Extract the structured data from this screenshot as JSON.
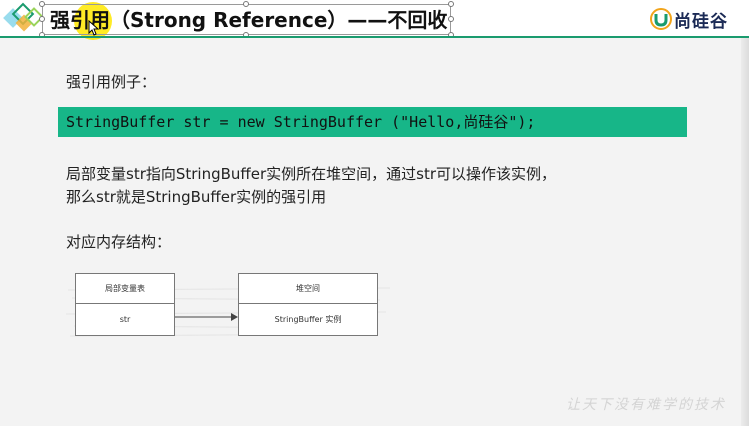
{
  "header": {
    "title": "强引用（Strong Reference）——不回收",
    "brand": "尚硅谷",
    "accent_color": "#1a9b6e"
  },
  "content": {
    "example_label": "强引用例子：",
    "code": "StringBuffer str = new StringBuffer (\"Hello,尚硅谷\");",
    "desc_line1": "局部变量str指向StringBuffer实例所在堆空间，通过str可以操作该实例，",
    "desc_line2": "那么str就是StringBuffer实例的强引用",
    "memory_label": "对应内存结构：",
    "code_bg": "#17b688"
  },
  "diagram": {
    "stack_header": "局部变量表",
    "stack_cell": "str",
    "heap_header": "堆空间",
    "heap_cell": "StringBuffer 实例"
  },
  "footer": {
    "watermark": "让天下没有难学的技术"
  }
}
